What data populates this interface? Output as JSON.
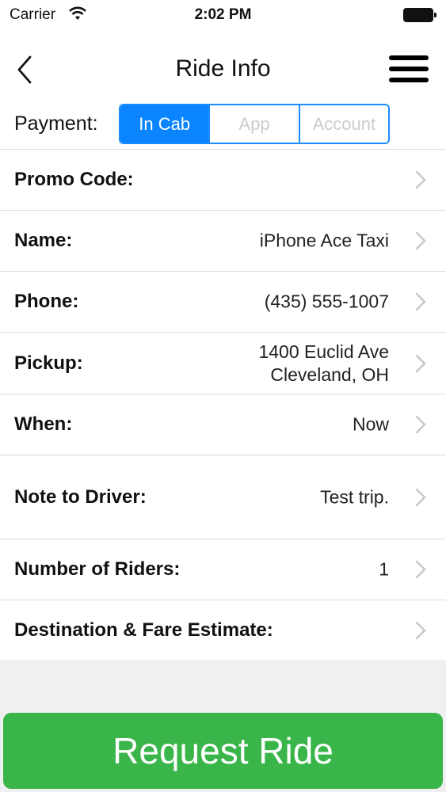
{
  "status_bar": {
    "carrier": "Carrier",
    "time": "2:02 PM"
  },
  "nav": {
    "title": "Ride Info",
    "back_icon": "chevron-left-icon",
    "menu_icon": "hamburger-menu-icon"
  },
  "payment": {
    "label": "Payment:",
    "options": [
      "In Cab",
      "App",
      "Account"
    ],
    "selected": "In Cab",
    "accent_color": "#0a84ff"
  },
  "rows": [
    {
      "label": "Promo Code:",
      "value": ""
    },
    {
      "label": "Name:",
      "value": "iPhone Ace Taxi"
    },
    {
      "label": "Phone:",
      "value": "(435) 555-1007"
    },
    {
      "label": "Pickup:",
      "value": "1400 Euclid Ave\nCleveland, OH"
    },
    {
      "label": "When:",
      "value": "Now"
    },
    {
      "label": "Note to Driver:",
      "value": "Test trip."
    },
    {
      "label": "Number of Riders:",
      "value": "1"
    },
    {
      "label": "Destination & Fare Estimate:",
      "value": ""
    }
  ],
  "request_button": {
    "label": "Request Ride",
    "color": "#39b54a"
  }
}
